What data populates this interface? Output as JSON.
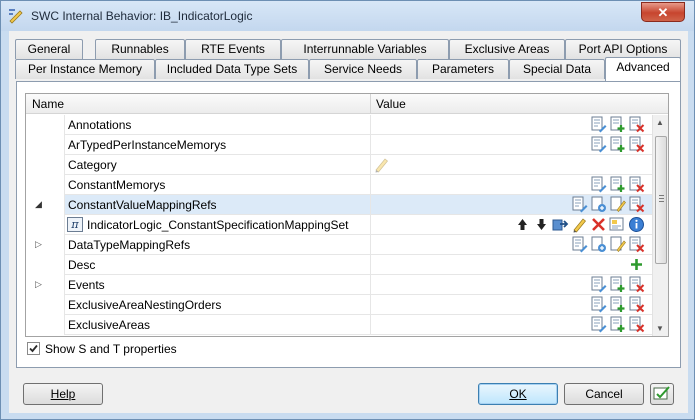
{
  "window": {
    "title": "SWC Internal Behavior: IB_IndicatorLogic",
    "close_glyph": "✕"
  },
  "tabs": {
    "row1": [
      "General",
      "Runnables",
      "RTE Events",
      "Interrunnable Variables",
      "Exclusive Areas",
      "Port API Options"
    ],
    "row2": [
      "Per Instance Memory",
      "Included Data Type Sets",
      "Service Needs",
      "Parameters",
      "Special Data",
      "Advanced"
    ],
    "active": "Advanced"
  },
  "grid": {
    "columns": {
      "name": "Name",
      "value": "Value"
    },
    "rows": [
      {
        "name": "Annotations",
        "icons": [
          "edit-list-icon",
          "add-item-icon",
          "delete-item-icon"
        ]
      },
      {
        "name": "ArTypedPerInstanceMemorys",
        "icons": [
          "edit-list-icon",
          "add-item-icon",
          "delete-item-icon"
        ]
      },
      {
        "name": "Category",
        "icons": [
          "pencil-icon"
        ]
      },
      {
        "name": "ConstantMemorys",
        "icons": [
          "edit-list-icon",
          "add-item-icon",
          "delete-item-icon"
        ]
      },
      {
        "name": "ConstantValueMappingRefs",
        "expander": "open",
        "selected": true,
        "icons": [
          "edit-list-icon",
          "reference-icon",
          "edit-ref-icon",
          "delete-item-icon"
        ]
      },
      {
        "name": "IndicatorLogic_ConstantSpecificationMappingSet",
        "child": true,
        "icons": [
          "move-up-icon",
          "move-down-icon",
          "navigate-icon",
          "pencil-icon",
          "delete-x-icon",
          "properties-icon",
          "info-icon"
        ]
      },
      {
        "name": "DataTypeMappingRefs",
        "expander": "closed",
        "icons": [
          "edit-list-icon",
          "reference-icon",
          "edit-ref-icon",
          "delete-item-icon"
        ]
      },
      {
        "name": "Desc",
        "icons": [
          "plus-icon"
        ]
      },
      {
        "name": "Events",
        "expander": "closed",
        "icons": [
          "edit-list-icon",
          "add-item-icon",
          "delete-item-icon"
        ]
      },
      {
        "name": "ExclusiveAreaNestingOrders",
        "icons": [
          "edit-list-icon",
          "add-item-icon",
          "delete-item-icon"
        ]
      },
      {
        "name": "ExclusiveAreas",
        "icons": [
          "edit-list-icon",
          "add-item-icon",
          "delete-item-icon"
        ]
      }
    ]
  },
  "show_st": {
    "label": "Show S and T properties",
    "checked": true
  },
  "buttons": {
    "help": "Help",
    "ok": "OK",
    "cancel": "Cancel"
  },
  "colors": {
    "accent": "#3c7fb1",
    "selected_row": "#dceaf8",
    "delete_red": "#d9322a",
    "add_green": "#2e9a2e"
  }
}
